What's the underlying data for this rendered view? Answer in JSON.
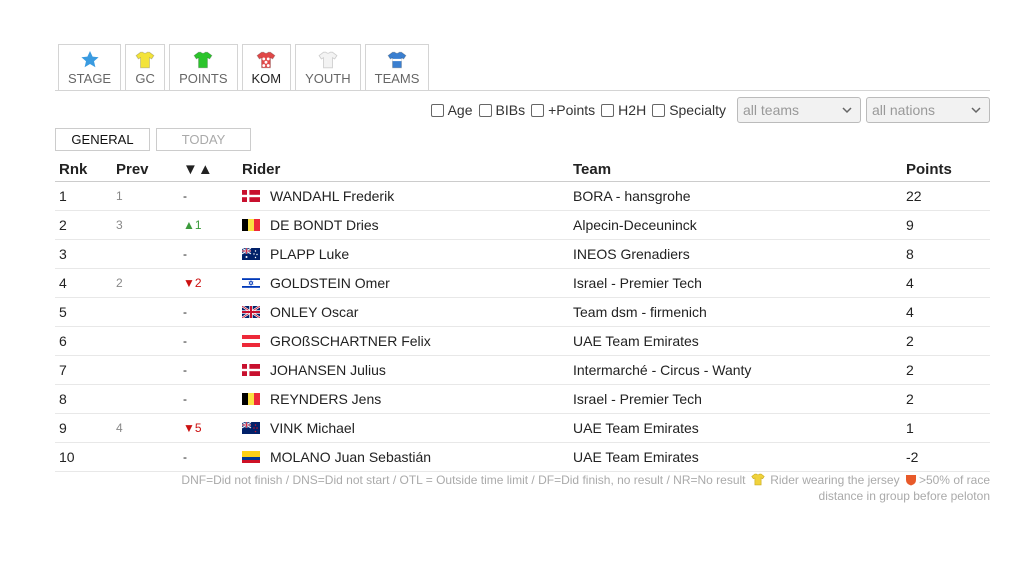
{
  "tabs": [
    {
      "label": "STAGE",
      "icon": "star-icon",
      "color": "#3a9be0"
    },
    {
      "label": "GC",
      "icon": "jersey-icon",
      "color": "#f3e33a"
    },
    {
      "label": "POINTS",
      "icon": "jersey-icon",
      "color": "#2bc42b"
    },
    {
      "label": "KOM",
      "icon": "jersey-icon",
      "color": "#e04848"
    },
    {
      "label": "YOUTH",
      "icon": "jersey-icon",
      "color": "#f3f3f3"
    },
    {
      "label": "TEAMS",
      "icon": "jersey-icon",
      "color": "#3a7fd0"
    }
  ],
  "filters": {
    "age": "Age",
    "bibs": "BIBs",
    "points": "+Points",
    "h2h": "H2H",
    "specialty": "Specialty",
    "teams_select": "all teams",
    "nations_select": "all nations"
  },
  "subtabs": {
    "general": "GENERAL",
    "today": "TODAY"
  },
  "table": {
    "headers": {
      "rnk": "Rnk",
      "prev": "Prev",
      "chg": "▼▲",
      "rider": "Rider",
      "team": "Team",
      "points": "Points"
    },
    "rows": [
      {
        "rnk": "1",
        "prev": "1",
        "chg": "-",
        "dir": "",
        "flag": "dk",
        "rider": "WANDAHL Frederik",
        "team": "BORA - hansgrohe",
        "points": "22"
      },
      {
        "rnk": "2",
        "prev": "3",
        "chg": "▲1",
        "dir": "up",
        "flag": "be",
        "rider": "DE BONDT Dries",
        "team": "Alpecin-Deceuninck",
        "points": "9"
      },
      {
        "rnk": "3",
        "prev": "",
        "chg": "-",
        "dir": "",
        "flag": "au",
        "rider": "PLAPP Luke",
        "team": "INEOS Grenadiers",
        "points": "8"
      },
      {
        "rnk": "4",
        "prev": "2",
        "chg": "▼2",
        "dir": "down",
        "flag": "il",
        "rider": "GOLDSTEIN Omer",
        "team": "Israel - Premier Tech",
        "points": "4"
      },
      {
        "rnk": "5",
        "prev": "",
        "chg": "-",
        "dir": "",
        "flag": "gb",
        "rider": "ONLEY Oscar",
        "team": "Team dsm - firmenich",
        "points": "4"
      },
      {
        "rnk": "6",
        "prev": "",
        "chg": "-",
        "dir": "",
        "flag": "at",
        "rider": "GROßSCHARTNER Felix",
        "team": "UAE Team Emirates",
        "points": "2"
      },
      {
        "rnk": "7",
        "prev": "",
        "chg": "-",
        "dir": "",
        "flag": "dk",
        "rider": "JOHANSEN Julius",
        "team": "Intermarché - Circus - Wanty",
        "points": "2"
      },
      {
        "rnk": "8",
        "prev": "",
        "chg": "-",
        "dir": "",
        "flag": "be",
        "rider": "REYNDERS Jens",
        "team": "Israel - Premier Tech",
        "points": "2"
      },
      {
        "rnk": "9",
        "prev": "4",
        "chg": "▼5",
        "dir": "down",
        "flag": "nz",
        "rider": "VINK Michael",
        "team": "UAE Team Emirates",
        "points": "1"
      },
      {
        "rnk": "10",
        "prev": "",
        "chg": "-",
        "dir": "",
        "flag": "co",
        "rider": "MOLANO Juan Sebastián",
        "team": "UAE Team Emirates",
        "points": "-2"
      }
    ]
  },
  "legend": {
    "text": "DNF=Did not finish / DNS=Did not start / OTL = Outside time limit / DF=Did finish, no result / NR=No result",
    "jersey_text": "Rider wearing the jersey",
    "shield_text": ">50% of race",
    "line2": "distance in group before peloton"
  }
}
